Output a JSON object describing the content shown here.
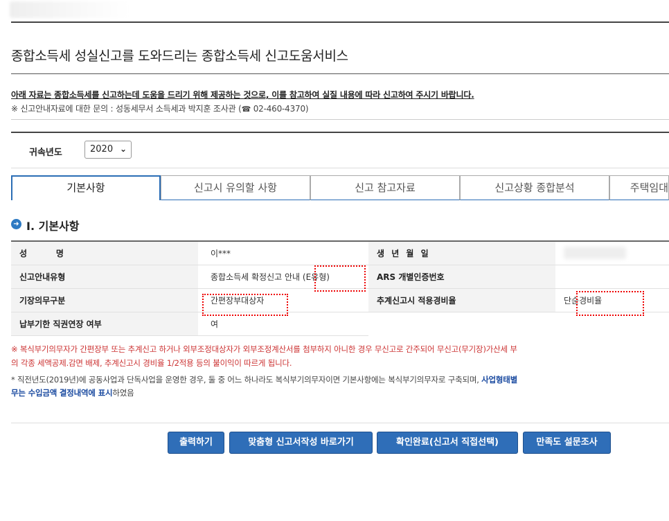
{
  "page": {
    "title": "종합소득세 성실신고를 도와드리는 종합소득세 신고도움서비스",
    "notice": "아래 자료는 종합소득세를 신고하는데 도움을 드리기 위해 제공하는 것으로, 이를 참고하여 실질 내용에 따라 신고하여 주시기 바랍니다.",
    "contact_prefix": "※ 신고안내자료에 대한 문의 : 성동세무서 소득세과 박지훈 조사관 (",
    "contact_phone": "02-460-4370",
    "contact_suffix": ")"
  },
  "year_filter": {
    "label": "귀속년도",
    "selected": "2020"
  },
  "tabs": [
    {
      "label": "기본사항",
      "active": true
    },
    {
      "label": "신고시 유의할 사항",
      "active": false
    },
    {
      "label": "신고 참고자료",
      "active": false
    },
    {
      "label": "신고상황 종합분석",
      "active": false
    },
    {
      "label": "주택임대",
      "active": false
    }
  ],
  "section": {
    "title": "Ⅰ. 기본사항"
  },
  "info": {
    "rows": [
      {
        "label1": "성          명",
        "value1": "이***",
        "label2": "생 년 월 일",
        "value2": ""
      },
      {
        "label1": "신고안내유형",
        "value1": "종합소득세 확정신고 안내 (E유형)",
        "label2": "ARS 개별인증번호",
        "value2": ""
      },
      {
        "label1": "기장의무구분",
        "value1": "간편장부대상자",
        "label2": "추계신고시 적용경비율",
        "value2": "단순경비율"
      },
      {
        "label1": "납부기한 직권연장 여부",
        "value1": "여",
        "label2": "",
        "value2": ""
      }
    ]
  },
  "notes": {
    "line1": "※ 복식부기의무자가 간편장부 또는 추계신고 하거나 외부조정대상자가 외부조정계산서를 첨부하지 아니한 경우 무신고로 간주되어 무신고(무기장)가산세 부",
    "line2": "의 각종 세액공제.감면 배제, 추계신고시 경비율 1/2적용 등의 불이익이 따르게 됩니다.",
    "line3_a": "* 직전년도(2019년)에 공동사업과 단독사업을 운영한 경우, 둘 중 어느 하나라도 복식부기의무자이면 기본사항에는 복식부기의무자로 구축되며, ",
    "line3_b": "사업형태별",
    "line4_a": "무는 수입금액 결정내역에 표시",
    "line4_b": "하였음"
  },
  "buttons": {
    "print": "출력하기",
    "custom": "맞춤형 신고서작성 바로가기",
    "confirm": "확인완료(신고서 직접선택)",
    "survey": "만족도 설문조사"
  },
  "colors": {
    "accent": "#2f6eb8",
    "highlight": "#e00000"
  }
}
